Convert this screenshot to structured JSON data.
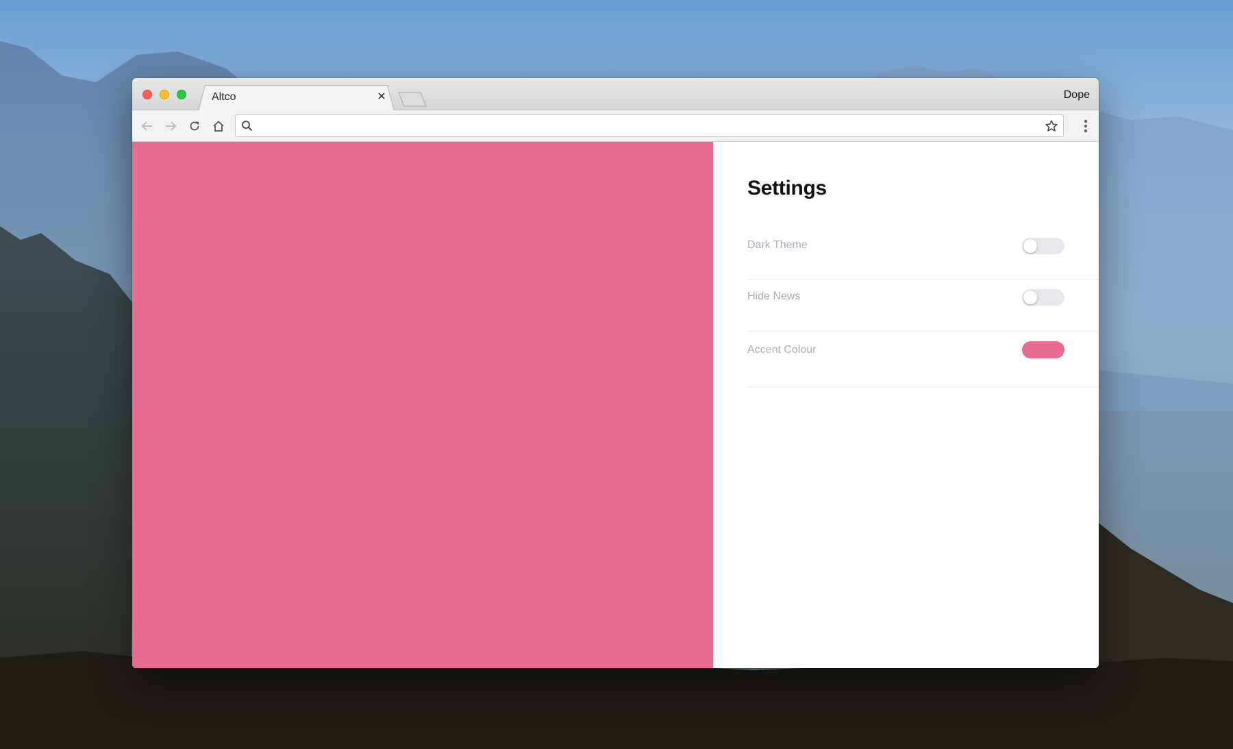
{
  "window": {
    "tab_title": "Altco",
    "profile_name": "Dope"
  },
  "toolbar": {
    "address_value": "",
    "icons": {
      "back": "back-arrow-icon",
      "forward": "forward-arrow-icon",
      "reload": "reload-icon",
      "home": "home-icon",
      "search": "search-icon",
      "bookmark": "star-icon",
      "menu": "kebab-menu-icon"
    }
  },
  "settings": {
    "title": "Settings",
    "items": [
      {
        "label": "Dark Theme",
        "control": "toggle",
        "enabled": false
      },
      {
        "label": "Hide News",
        "control": "toggle",
        "enabled": false
      },
      {
        "label": "Accent Colour",
        "control": "color",
        "value": "#e86b91"
      }
    ]
  },
  "colors": {
    "accent": "#e86b91",
    "toggle_off": "#e6e8ec",
    "label": "#a6acb8"
  }
}
